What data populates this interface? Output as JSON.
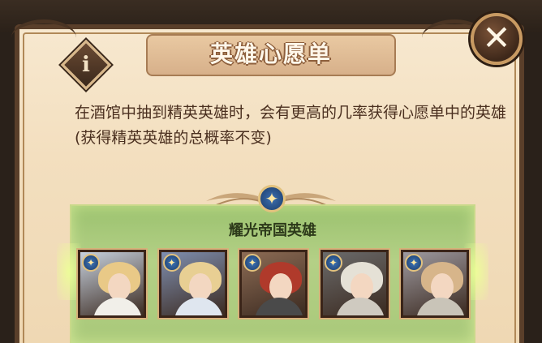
{
  "title": "英雄心愿单",
  "description": "在酒馆中抽到精英英雄时，会有更高的几率获得心愿单中的英雄(获得精英英雄的总概率不变)",
  "faction": {
    "label": "耀光帝国英雄",
    "heroes": [
      {
        "hair": "#e9c987",
        "body": "#f1efe9",
        "bg": "#c7d1de"
      },
      {
        "hair": "#e8cf93",
        "body": "#dfe6ef",
        "bg": "#7f8fb0"
      },
      {
        "hair": "#b03a2b",
        "body": "#4a4a4a",
        "bg": "#8d6c55"
      },
      {
        "hair": "#e5e1d6",
        "body": "#cfcac0",
        "bg": "#6b6b6b"
      },
      {
        "hair": "#d7b58a",
        "body": "#c9c4b8",
        "bg": "#9e9aa0"
      }
    ]
  },
  "icons": {
    "info": "i",
    "close": "✕",
    "star": "✦"
  }
}
